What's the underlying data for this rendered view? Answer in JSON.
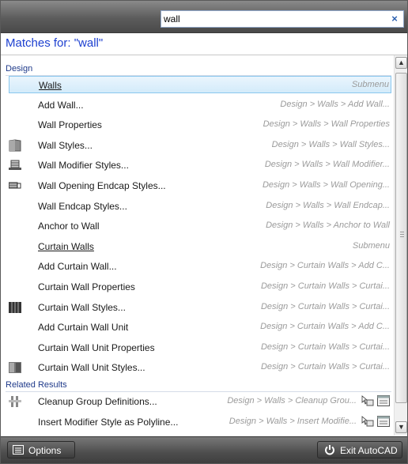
{
  "search": {
    "value": "wall",
    "clear_icon": "×"
  },
  "matches_label": "Matches for: \"wall\"",
  "sections": {
    "design": "Design",
    "related": "Related Results"
  },
  "design_items": [
    {
      "label": "Walls",
      "path": "Submenu",
      "underline": true,
      "icon": "none",
      "selected": true
    },
    {
      "label": "Add Wall...",
      "path": "Design > Walls > Add Wall...",
      "underline": false,
      "icon": "none"
    },
    {
      "label": "Wall Properties",
      "path": "Design > Walls > Wall Properties",
      "underline": false,
      "icon": "none"
    },
    {
      "label": "Wall Styles...",
      "path": "Design > Walls > Wall Styles...",
      "underline": false,
      "icon": "wall-style-icon"
    },
    {
      "label": "Wall Modifier Styles...",
      "path": "Design > Walls > Wall Modifier...",
      "underline": false,
      "icon": "wall-modifier-icon"
    },
    {
      "label": "Wall Opening Endcap Styles...",
      "path": "Design > Walls > Wall Opening...",
      "underline": false,
      "icon": "wall-opening-endcap-icon"
    },
    {
      "label": "Wall Endcap Styles...",
      "path": "Design > Walls > Wall Endcap...",
      "underline": false,
      "icon": "none"
    },
    {
      "label": "Anchor to Wall",
      "path": "Design > Walls > Anchor to Wall",
      "underline": false,
      "icon": "none"
    },
    {
      "label": "Curtain Walls",
      "path": "Submenu",
      "underline": true,
      "icon": "none"
    },
    {
      "label": "Add Curtain Wall...",
      "path": "Design > Curtain Walls > Add C...",
      "underline": false,
      "icon": "none"
    },
    {
      "label": "Curtain Wall Properties",
      "path": "Design > Curtain Walls > Curtai...",
      "underline": false,
      "icon": "none"
    },
    {
      "label": "Curtain Wall Styles...",
      "path": "Design > Curtain Walls > Curtai...",
      "underline": false,
      "icon": "curtain-wall-style-icon"
    },
    {
      "label": "Add Curtain Wall Unit",
      "path": "Design > Curtain Walls > Add C...",
      "underline": false,
      "icon": "none"
    },
    {
      "label": "Curtain Wall Unit Properties",
      "path": "Design > Curtain Walls > Curtai...",
      "underline": false,
      "icon": "none"
    },
    {
      "label": "Curtain Wall Unit Styles...",
      "path": "Design > Curtain Walls > Curtai...",
      "underline": false,
      "icon": "curtain-wall-unit-style-icon"
    }
  ],
  "related_items": [
    {
      "label": "Cleanup Group Definitions...",
      "path": "Design > Walls > Cleanup Grou...",
      "icon": "cleanup-group-icon"
    },
    {
      "label": "Insert Modifier Style as Polyline...",
      "path": "Design > Walls > Insert Modifie...",
      "icon": "none"
    }
  ],
  "footer": {
    "options_label": "Options",
    "exit_label": "Exit AutoCAD"
  },
  "colors": {
    "matches_text": "#1c3fd0",
    "section_text": "#1f3a8a",
    "selection": "#d3ebfa",
    "path_text": "#9b9b9b"
  }
}
